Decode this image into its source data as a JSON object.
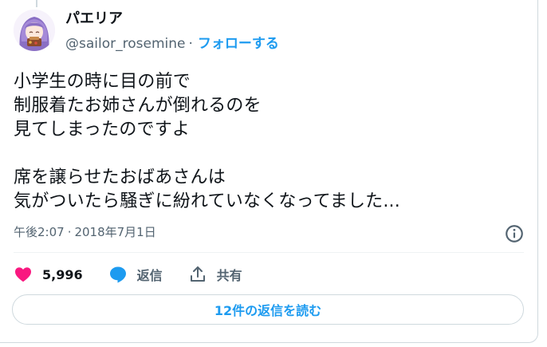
{
  "author": {
    "display_name": "パエリア",
    "handle": "@sailor_rosemine",
    "separator": "·",
    "follow_label": "フォローする"
  },
  "tweet": {
    "text": "小学生の時に目の前で\n制服着たお姉さんが倒れるのを\n見てしまったのですよ\n\n席を譲らせたおばあさんは\n気がついたら騒ぎに紛れていなくなってました..."
  },
  "timestamp": {
    "time": "午後2:07",
    "separator": "·",
    "date": "2018年7月1日"
  },
  "actions": {
    "like_count": "5,996",
    "reply_label": "返信",
    "share_label": "共有"
  },
  "replies_button": {
    "label": "12件の返信を読む"
  },
  "icons": {
    "like": "heart-icon",
    "reply": "speech-bubble-icon",
    "share": "share-upload-icon",
    "info": "info-icon"
  },
  "colors": {
    "like": "#f91880",
    "reply": "#1d9bf0",
    "link": "#1d9bf0",
    "muted": "#536471",
    "text": "#0f1419"
  }
}
